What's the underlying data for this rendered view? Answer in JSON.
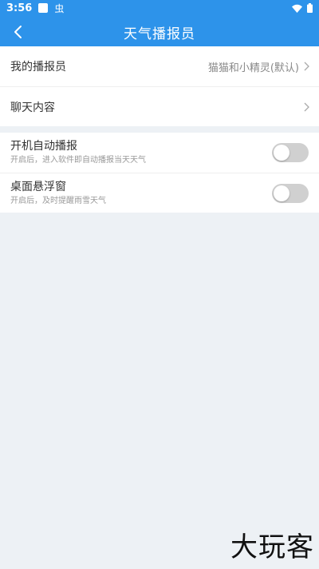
{
  "status": {
    "time": "3:56",
    "notif_icon": "虫"
  },
  "header": {
    "title": "天气播报员"
  },
  "settings": {
    "my_broadcaster": {
      "label": "我的播报员",
      "value": "猫猫和小精灵(默认)"
    },
    "chat_content": {
      "label": "聊天内容"
    },
    "auto_broadcast": {
      "label": "开机自动播报",
      "subtitle": "开启后，进入软件即自动播报当天天气",
      "enabled": false
    },
    "desktop_float": {
      "label": "桌面悬浮窗",
      "subtitle": "开启后，及时提醒雨雪天气",
      "enabled": false
    }
  },
  "watermark": {
    "text": "大玩客"
  },
  "colors": {
    "accent": "#2d93ea",
    "background": "#edf1f5",
    "switch_off": "#d0d0d0"
  }
}
